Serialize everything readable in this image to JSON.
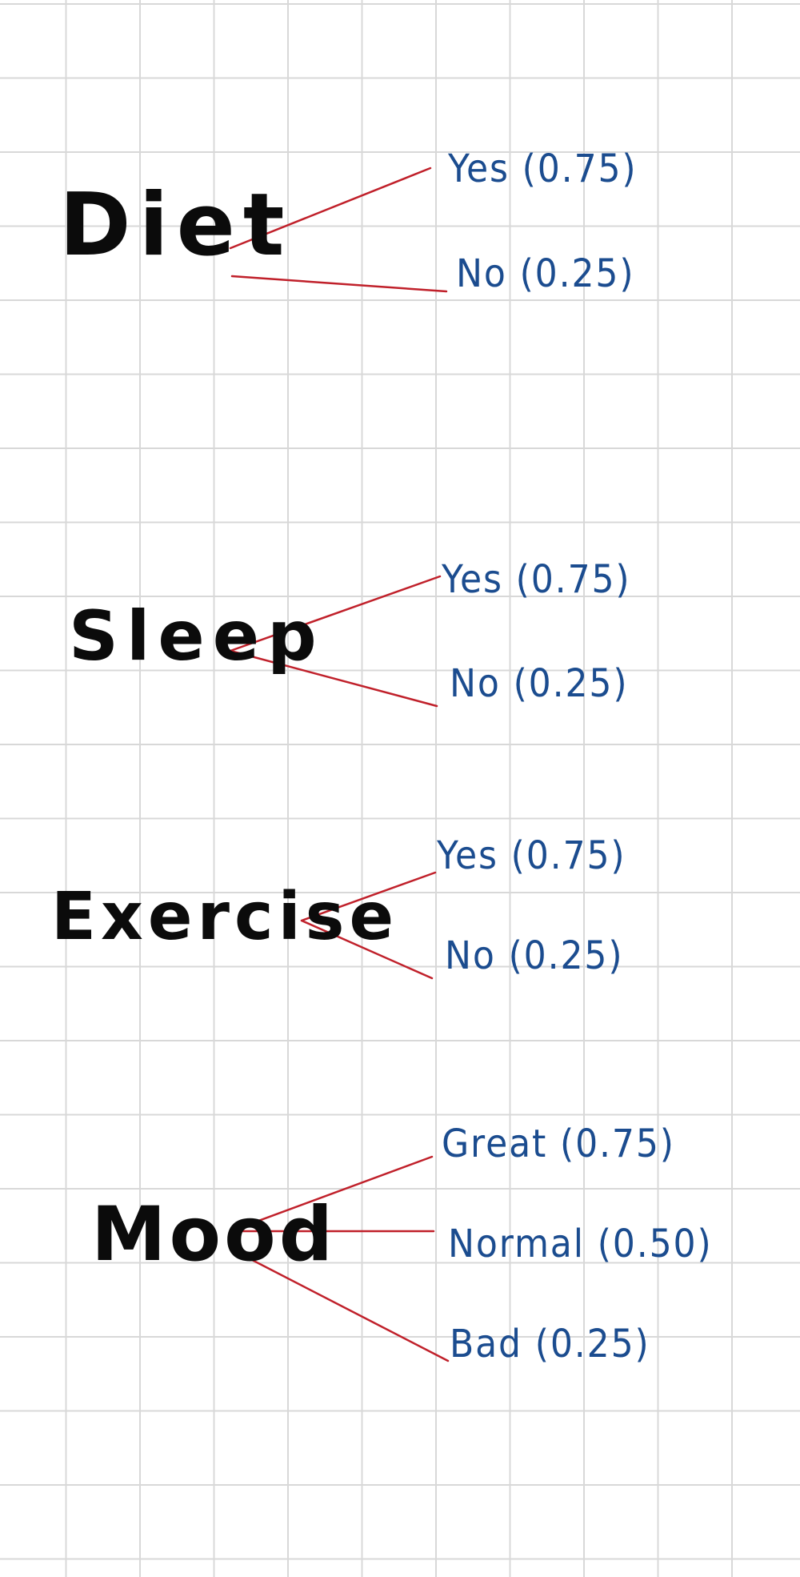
{
  "colors": {
    "factor_text": "#0b0b0b",
    "option_text": "#1b4c8f",
    "branch_line": "#c0202a",
    "grid": "#d8d8d8"
  },
  "factors": [
    {
      "label": "Diet",
      "options": [
        "Yes (0.75)",
        "No (0.25)"
      ]
    },
    {
      "label": "Sleep",
      "options": [
        "Yes (0.75)",
        "No (0.25)"
      ]
    },
    {
      "label": "Exercise",
      "options": [
        "Yes (0.75)",
        "No (0.25)"
      ]
    },
    {
      "label": "Mood",
      "options": [
        "Great (0.75)",
        "Normal (0.50)",
        "Bad (0.25)"
      ]
    }
  ]
}
